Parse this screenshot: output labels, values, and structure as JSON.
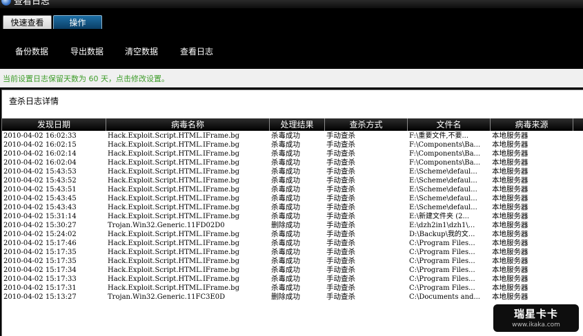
{
  "window": {
    "title": "查看日志"
  },
  "tabs": [
    {
      "label": "快速查看"
    },
    {
      "label": "操作"
    }
  ],
  "toolbar": {
    "buttons": [
      {
        "label": "备份数据"
      },
      {
        "label": "导出数据"
      },
      {
        "label": "清空数据"
      },
      {
        "label": "查看日志"
      }
    ]
  },
  "notice": "当前设置日志保留天数为 60 天，点击修改设置。",
  "panel": {
    "title": "查杀日志详情"
  },
  "table": {
    "columns": [
      "发现日期",
      "病毒名称",
      "处理结果",
      "查杀方式",
      "文件名",
      "病毒来源"
    ],
    "rows": [
      [
        "2010-04-02 16:02:33",
        "Hack.Exploit.Script.HTML.IFrame.bg",
        "杀毒成功",
        "手动查杀",
        "F:\\重要文件,不要...",
        "本地服务器"
      ],
      [
        "2010-04-02 16:02:15",
        "Hack.Exploit.Script.HTML.IFrame.bg",
        "杀毒成功",
        "手动查杀",
        "F:\\Components\\Ba...",
        "本地服务器"
      ],
      [
        "2010-04-02 16:02:14",
        "Hack.Exploit.Script.HTML.IFrame.bg",
        "杀毒成功",
        "手动查杀",
        "F:\\Components\\Ba...",
        "本地服务器"
      ],
      [
        "2010-04-02 16:02:04",
        "Hack.Exploit.Script.HTML.IFrame.bg",
        "杀毒成功",
        "手动查杀",
        "F:\\Components\\Ba...",
        "本地服务器"
      ],
      [
        "2010-04-02 15:43:53",
        "Hack.Exploit.Script.HTML.IFrame.bg",
        "杀毒成功",
        "手动查杀",
        "E:\\Scheme\\defaul...",
        "本地服务器"
      ],
      [
        "2010-04-02 15:43:52",
        "Hack.Exploit.Script.HTML.IFrame.bg",
        "杀毒成功",
        "手动查杀",
        "E:\\Scheme\\defaul...",
        "本地服务器"
      ],
      [
        "2010-04-02 15:43:51",
        "Hack.Exploit.Script.HTML.IFrame.bg",
        "杀毒成功",
        "手动查杀",
        "E:\\Scheme\\defaul...",
        "本地服务器"
      ],
      [
        "2010-04-02 15:43:45",
        "Hack.Exploit.Script.HTML.IFrame.bg",
        "杀毒成功",
        "手动查杀",
        "E:\\Scheme\\defaul...",
        "本地服务器"
      ],
      [
        "2010-04-02 15:43:43",
        "Hack.Exploit.Script.HTML.IFrame.bg",
        "杀毒成功",
        "手动查杀",
        "E:\\Scheme\\defaul...",
        "本地服务器"
      ],
      [
        "2010-04-02 15:31:14",
        "Hack.Exploit.Script.HTML.IFrame.bg",
        "杀毒成功",
        "手动查杀",
        "E:\\新建文件夹 (2...",
        "本地服务器"
      ],
      [
        "2010-04-02 15:30:27",
        "Trojan.Win32.Generic.11FD02D0",
        "删除成功",
        "手动查杀",
        "E:\\dzh2in1\\dzh1\\...",
        "本地服务器"
      ],
      [
        "2010-04-02 15:24:02",
        "Hack.Exploit.Script.HTML.IFrame.bg",
        "杀毒成功",
        "手动查杀",
        "D:\\Backup\\我的文...",
        "本地服务器"
      ],
      [
        "2010-04-02 15:17:46",
        "Hack.Exploit.Script.HTML.IFrame.bg",
        "杀毒成功",
        "手动查杀",
        "C:\\Program Files...",
        "本地服务器"
      ],
      [
        "2010-04-02 15:17:35",
        "Hack.Exploit.Script.HTML.IFrame.bg",
        "杀毒成功",
        "手动查杀",
        "C:\\Program Files...",
        "本地服务器"
      ],
      [
        "2010-04-02 15:17:35",
        "Hack.Exploit.Script.HTML.IFrame.bg",
        "杀毒成功",
        "手动查杀",
        "C:\\Program Files...",
        "本地服务器"
      ],
      [
        "2010-04-02 15:17:34",
        "Hack.Exploit.Script.HTML.IFrame.bg",
        "杀毒成功",
        "手动查杀",
        "C:\\Program Files...",
        "本地服务器"
      ],
      [
        "2010-04-02 15:17:33",
        "Hack.Exploit.Script.HTML.IFrame.bg",
        "杀毒成功",
        "手动查杀",
        "C:\\Program Files...",
        "本地服务器"
      ],
      [
        "2010-04-02 15:17:31",
        "Hack.Exploit.Script.HTML.IFrame.bg",
        "杀毒成功",
        "手动查杀",
        "C:\\Program Files...",
        "本地服务器"
      ],
      [
        "2010-04-02 15:13:27",
        "Trojan.Win32.Generic.11FC3E0D",
        "删除成功",
        "手动查杀",
        "C:\\Documents and...",
        "本地服务器"
      ]
    ]
  },
  "watermark": {
    "title": "瑞星卡卡",
    "url": "www.ikaka.com"
  },
  "colors": {
    "notice": "#3e9d2a",
    "active_tab": "#1d6fa5"
  }
}
